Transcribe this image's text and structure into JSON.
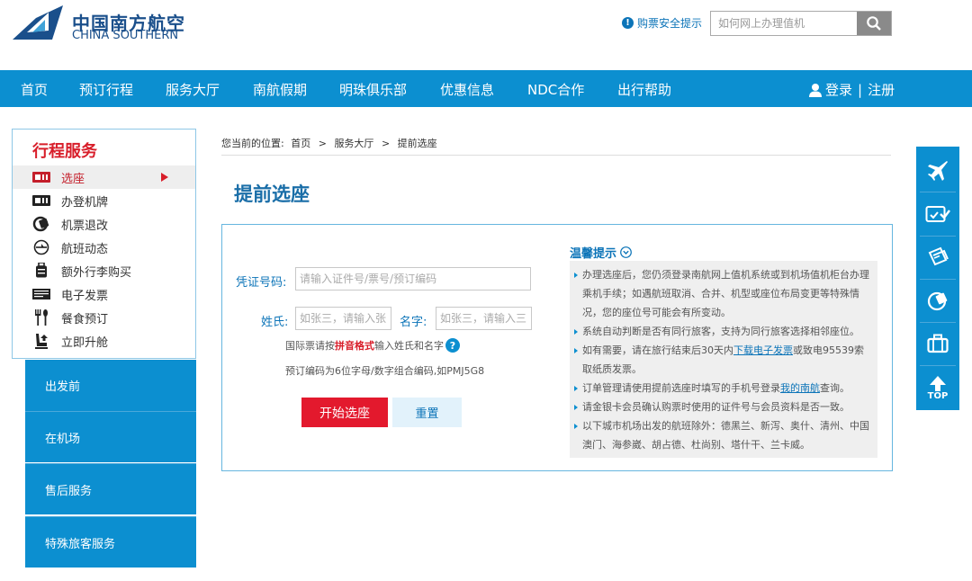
{
  "brand": {
    "name_cn": "中国南方航空",
    "name_en": "CHINA SOUTHERN"
  },
  "header": {
    "safety_tip": "购票安全提示",
    "search_placeholder": "如何网上办理值机"
  },
  "nav": {
    "items": [
      "首页",
      "预订行程",
      "服务大厅",
      "南航假期",
      "明珠俱乐部",
      "优惠信息",
      "NDC合作",
      "出行帮助"
    ],
    "login": "登录",
    "divider": "|",
    "register": "注册"
  },
  "sidebar": {
    "title": "行程服务",
    "items": [
      {
        "label": "选座",
        "icon": "seat-ticket-icon"
      },
      {
        "label": "办登机牌",
        "icon": "boarding-pass-icon"
      },
      {
        "label": "机票退改",
        "icon": "ticket-change-icon"
      },
      {
        "label": "航班动态",
        "icon": "flight-status-icon"
      },
      {
        "label": "额外行李购买",
        "icon": "luggage-icon"
      },
      {
        "label": "电子发票",
        "icon": "e-invoice-icon"
      },
      {
        "label": "餐食预订",
        "icon": "meal-icon"
      },
      {
        "label": "立即升舱",
        "icon": "upgrade-seat-icon"
      }
    ],
    "groups": [
      "出发前",
      "在机场",
      "售后服务",
      "特殊旅客服务"
    ]
  },
  "breadcrumb": {
    "prefix": "您当前的位置:",
    "items": [
      "首页",
      "服务大厅",
      "提前选座"
    ],
    "separator": ">"
  },
  "page": {
    "title": "提前选座"
  },
  "form": {
    "id_label": "凭证号码:",
    "id_placeholder": "请输入证件号/票号/预订编码",
    "surname_label": "姓氏:",
    "surname_placeholder": "如张三，请输入张",
    "given_label": "名字:",
    "given_placeholder": "如张三，请输入三",
    "intl_hint_before": "国际票请按",
    "intl_hint_emph": "拼音格式",
    "intl_hint_after": "输入姓氏和名字",
    "pnr_hint": "预订编码为6位字母/数字组合编码,如PMJ5G8",
    "start_button": "开始选座",
    "reset_button": "重置"
  },
  "tips": {
    "title": "温馨提示",
    "items": [
      {
        "text": "办理选座后，您仍须登录南航网上值机系统或到机场值机柜台办理乘机手续；如遇航班取消、合并、机型或座位布局变更等特殊情况，您的座位号可能会有所变动。"
      },
      {
        "text": "系统自动判断是否有同行旅客，支持为同行旅客选择相邻座位。"
      },
      {
        "before": "如有需要，请在旅行结束后30天内",
        "link": "下载电子发票",
        "after": "或致电95539索取纸质发票。"
      },
      {
        "before": "订单管理请使用提前选座时填写的手机号登录",
        "link": "我的南航",
        "after": "查询。"
      },
      {
        "text": "请金银卡会员确认购票时使用的证件号与会员资料是否一致。"
      },
      {
        "text": "以下城市机场出发的航班除外：德黑兰、新泻、奥什、清州、中国澳门、海参崴、胡占德、杜尚别、塔什干、兰卡威。"
      }
    ]
  },
  "rail": {
    "buttons": [
      "plane-icon",
      "checkin-icon",
      "ticket-icon",
      "coin-icon",
      "bag-icon",
      "back-to-top-icon"
    ],
    "top_label": "TOP"
  },
  "colors": {
    "primary_blue": "#0c8fd0",
    "brand_red": "#d81e2a",
    "logo_blue": "#1a4f8b"
  }
}
